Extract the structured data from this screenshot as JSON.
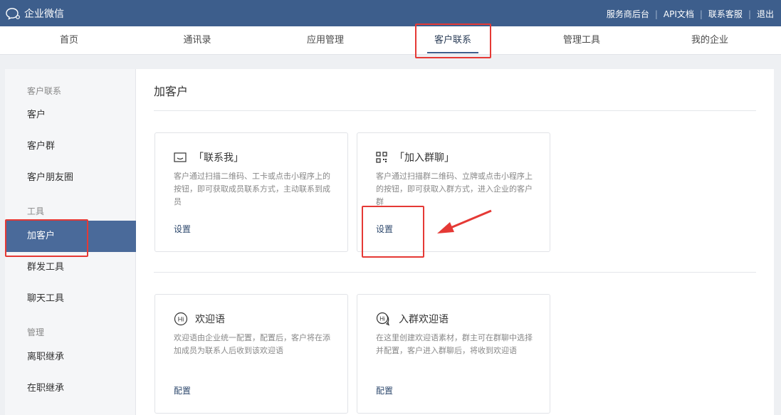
{
  "app": {
    "title": "企业微信"
  },
  "toplinks": [
    "服务商后台",
    "API文档",
    "联系客服",
    "退出"
  ],
  "nav": {
    "items": [
      "首页",
      "通讯录",
      "应用管理",
      "客户联系",
      "管理工具",
      "我的企业"
    ],
    "active": "客户联系"
  },
  "sidebar": {
    "group1": "客户联系",
    "group1_items": [
      "客户",
      "客户群",
      "客户朋友圈"
    ],
    "group2": "工具",
    "group2_items": [
      "加客户",
      "群发工具",
      "聊天工具"
    ],
    "group3": "管理",
    "group3_items": [
      "离职继承",
      "在职继承"
    ],
    "active": "加客户"
  },
  "main": {
    "title": "加客户",
    "cards": [
      {
        "icon": "chat-window-icon",
        "title": "「联系我」",
        "desc": "客户通过扫描二维码、工卡或点击小程序上的按钮，即可获取成员联系方式，主动联系到成员",
        "action": "设置"
      },
      {
        "icon": "qr-code-icon",
        "title": "「加入群聊」",
        "desc": "客户通过扫描群二维码、立牌或点击小程序上的按钮，即可获取入群方式，进入企业的客户群",
        "action": "设置"
      },
      {
        "icon": "hi-icon",
        "title": "欢迎语",
        "desc": "欢迎语由企业统一配置，配置后，客户将在添加成员为联系人后收到该欢迎语",
        "action": "配置"
      },
      {
        "icon": "hi-bubble-icon",
        "title": "入群欢迎语",
        "desc": "在这里创建欢迎语素材，群主可在群聊中选择并配置，客户进入群聊后，将收到欢迎语",
        "action": "配置"
      }
    ]
  },
  "colors": {
    "topbar": "#3d5e8c",
    "sidebar_active": "#4a6a9a",
    "highlight": "#e53935"
  }
}
